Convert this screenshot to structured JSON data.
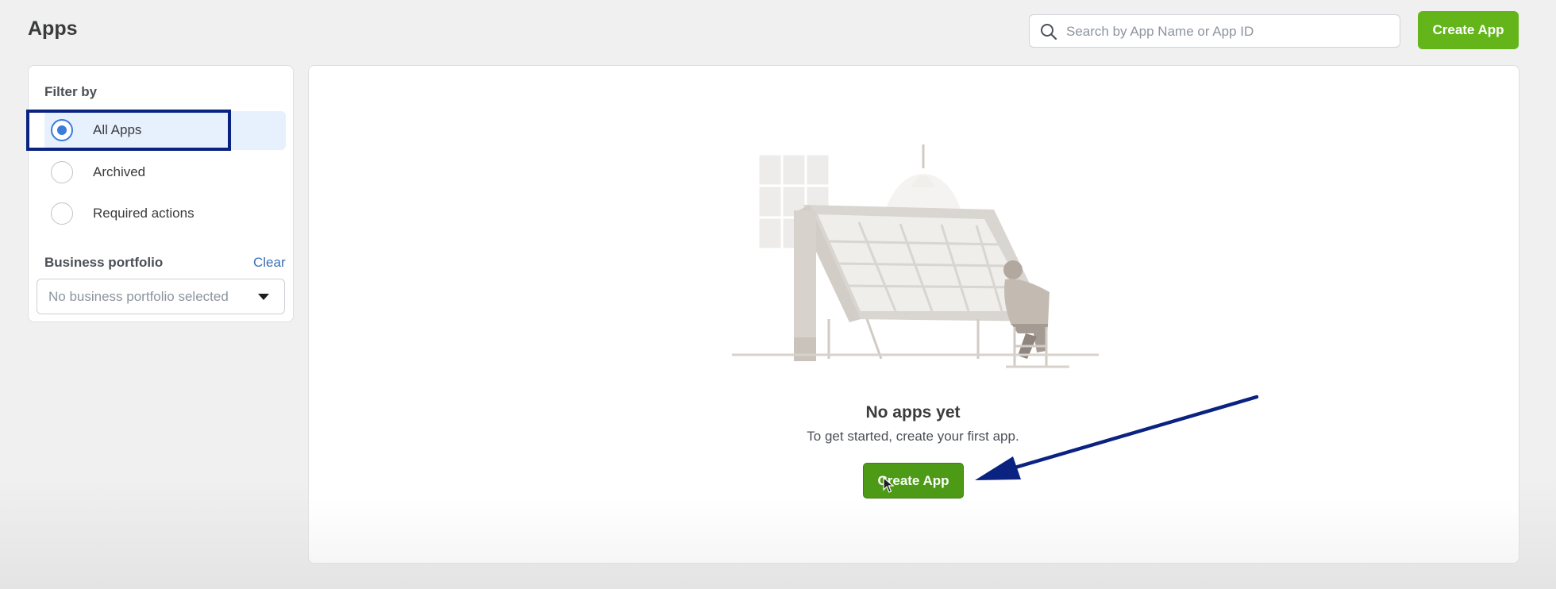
{
  "header": {
    "title": "Apps",
    "search_placeholder": "Search by App Name or App ID",
    "search_value": "",
    "create_label": "Create App"
  },
  "filter": {
    "heading": "Filter by",
    "options": [
      {
        "label": "All Apps",
        "selected": true
      },
      {
        "label": "Archived",
        "selected": false
      },
      {
        "label": "Required actions",
        "selected": false
      }
    ]
  },
  "business_portfolio": {
    "heading": "Business portfolio",
    "clear_label": "Clear",
    "selected_value": "No business portfolio selected"
  },
  "empty_state": {
    "title": "No apps yet",
    "subtitle": "To get started, create your first app.",
    "button_label": "Create App"
  },
  "colors": {
    "brand_green": "#63b51a",
    "button_green_dark": "#4c9a16",
    "radio_selected": "#3b7bd9",
    "annotation_navy": "#0a2280"
  },
  "icons": {
    "search": "search-icon",
    "dropdown": "caret-down-icon",
    "annotation": "arrow-annotation"
  }
}
